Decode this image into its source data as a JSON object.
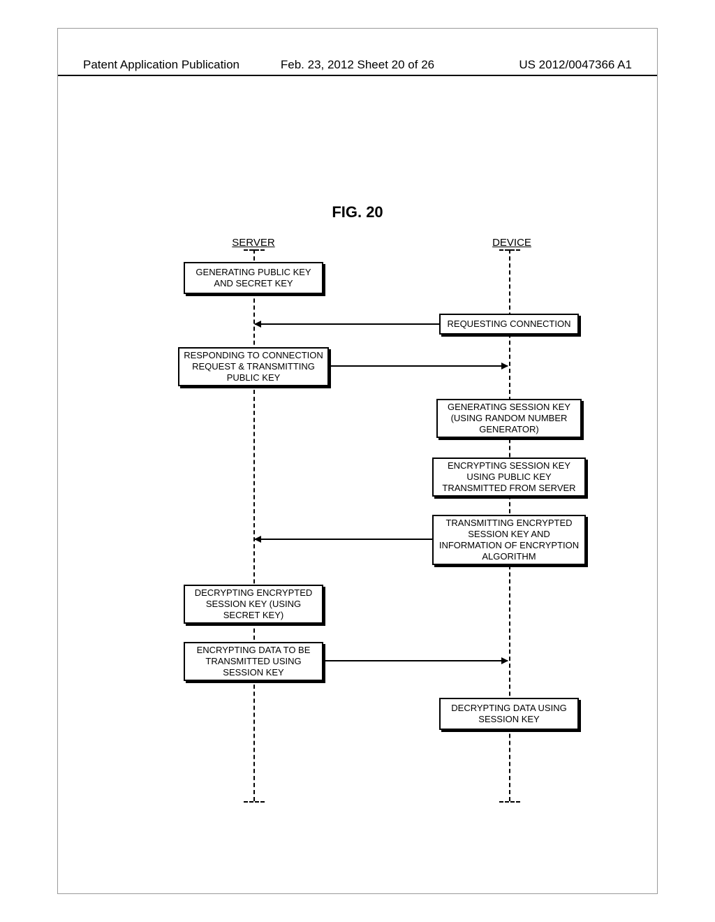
{
  "header": {
    "left": "Patent Application Publication",
    "center": "Feb. 23, 2012  Sheet 20 of 26",
    "right": "US 2012/0047366 A1"
  },
  "figure_title": "FIG. 20",
  "lanes": {
    "server": "SERVER",
    "device": "DEVICE"
  },
  "boxes": {
    "s1": "GENERATING PUBLIC KEY AND SECRET KEY",
    "d1": "REQUESTING CONNECTION",
    "s2": "RESPONDING TO CONNECTION REQUEST & TRANSMITTING PUBLIC KEY",
    "d2": "GENERATING SESSION KEY (USING RANDOM NUMBER GENERATOR)",
    "d3": "ENCRYPTING SESSION KEY USING PUBLIC KEY TRANSMITTED FROM SERVER",
    "d4": "TRANSMITTING ENCRYPTED SESSION KEY AND INFORMATION OF ENCRYPTION ALGORITHM",
    "s3": "DECRYPTING ENCRYPTED SESSION KEY (USING SECRET KEY)",
    "s4": "ENCRYPTING DATA TO BE TRANSMITTED USING SESSION KEY",
    "d5": "DECRYPTING DATA USING SESSION KEY"
  }
}
